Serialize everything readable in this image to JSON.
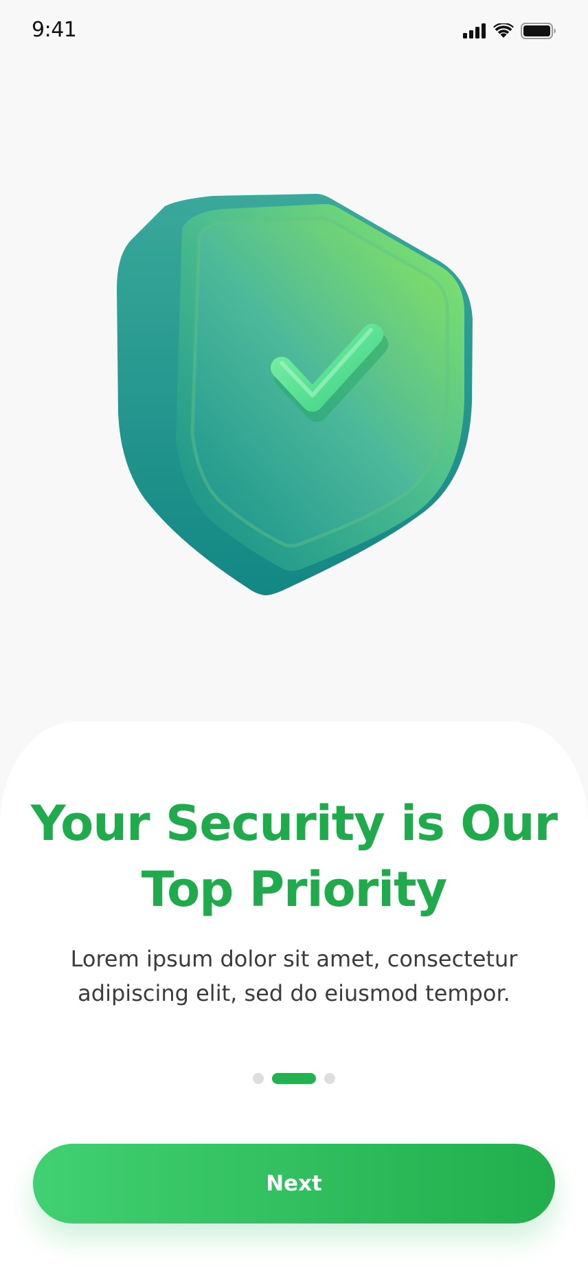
{
  "status_bar": {
    "time": "9:41",
    "icons": [
      "cellular-signal-icon",
      "wifi-icon",
      "battery-icon"
    ]
  },
  "hero": {
    "illustration": "shield-check-icon",
    "colors": {
      "shield_light": "#7be06a",
      "shield_dark": "#178f8a",
      "check": "#5ee898"
    }
  },
  "onboarding": {
    "title": "Your Security is Our Top Priority",
    "description": "Lorem ipsum dolor sit amet, consectetur adipiscing elit, sed do eiusmod tempor.",
    "pagination": {
      "total": 3,
      "current": 2
    },
    "next_label": "Next"
  },
  "theme": {
    "accent": "#1faa4b",
    "background": "#f8f8f8",
    "sheet": "#ffffff"
  }
}
